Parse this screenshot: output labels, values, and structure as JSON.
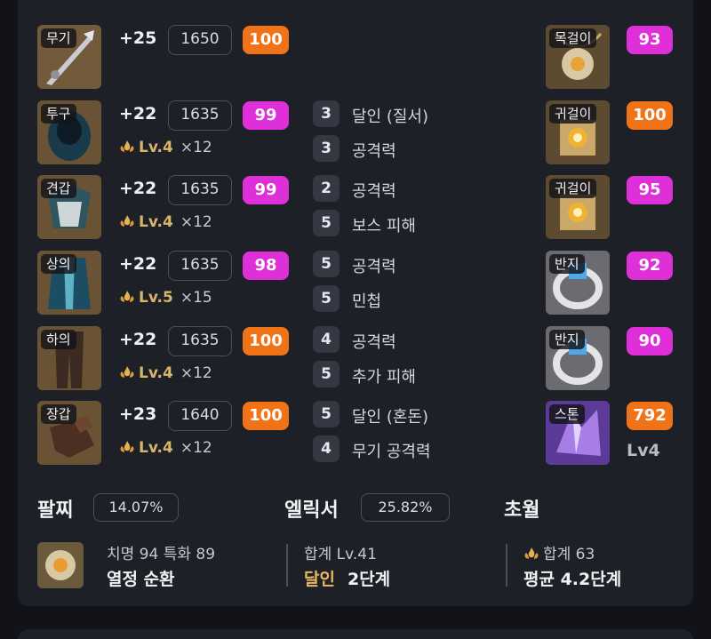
{
  "equipment": [
    {
      "slot": "무기",
      "plus": "+25",
      "ilvl": "1650",
      "quality": "100",
      "qcolor": "orange",
      "lvl": null,
      "count": null
    },
    {
      "slot": "투구",
      "plus": "+22",
      "ilvl": "1635",
      "quality": "99",
      "qcolor": "magenta",
      "lvl": "Lv.4",
      "count": "×12"
    },
    {
      "slot": "견갑",
      "plus": "+22",
      "ilvl": "1635",
      "quality": "99",
      "qcolor": "magenta",
      "lvl": "Lv.4",
      "count": "×12"
    },
    {
      "slot": "상의",
      "plus": "+22",
      "ilvl": "1635",
      "quality": "98",
      "qcolor": "magenta",
      "lvl": "Lv.5",
      "count": "×15"
    },
    {
      "slot": "하의",
      "plus": "+22",
      "ilvl": "1635",
      "quality": "100",
      "qcolor": "orange",
      "lvl": "Lv.4",
      "count": "×12"
    },
    {
      "slot": "장갑",
      "plus": "+23",
      "ilvl": "1640",
      "quality": "100",
      "qcolor": "orange",
      "lvl": "Lv.4",
      "count": "×12"
    }
  ],
  "engravings": [
    {
      "level": "3",
      "name": "달인 (질서)"
    },
    {
      "level": "3",
      "name": "공격력"
    },
    {
      "level": "2",
      "name": "공격력"
    },
    {
      "level": "5",
      "name": "보스 피해"
    },
    {
      "level": "5",
      "name": "공격력"
    },
    {
      "level": "5",
      "name": "민첩"
    },
    {
      "level": "4",
      "name": "공격력"
    },
    {
      "level": "5",
      "name": "추가 피해"
    },
    {
      "level": "5",
      "name": "달인 (혼돈)"
    },
    {
      "level": "4",
      "name": "무기 공격력"
    }
  ],
  "accessories": [
    {
      "slot": "목걸이",
      "quality": "93",
      "qcolor": "magenta"
    },
    {
      "slot": "귀걸이",
      "quality": "100",
      "qcolor": "orange"
    },
    {
      "slot": "귀걸이",
      "quality": "95",
      "qcolor": "magenta"
    },
    {
      "slot": "반지",
      "quality": "92",
      "qcolor": "magenta"
    },
    {
      "slot": "반지",
      "quality": "90",
      "qcolor": "magenta"
    }
  ],
  "stone": {
    "slot": "스톤",
    "value": "792",
    "qcolor": "orange",
    "level": "Lv4"
  },
  "bracelet": {
    "title": "팔찌",
    "percent": "14.07%",
    "stats": "치명 94  특화 89",
    "effects": "열정  순환"
  },
  "elixir": {
    "title": "엘릭서",
    "percent": "25.82%",
    "total": "합계 Lv.41",
    "effect_name": "달인",
    "effect_stage": "2단계"
  },
  "transcend": {
    "title": "초월",
    "total": "합계 63",
    "average": "평균 4.2단계"
  },
  "colors": {
    "orange": "#f07318",
    "magenta": "#de2fd8",
    "gold": "#e5b861"
  },
  "icons": {
    "flame": "flame-icon"
  }
}
